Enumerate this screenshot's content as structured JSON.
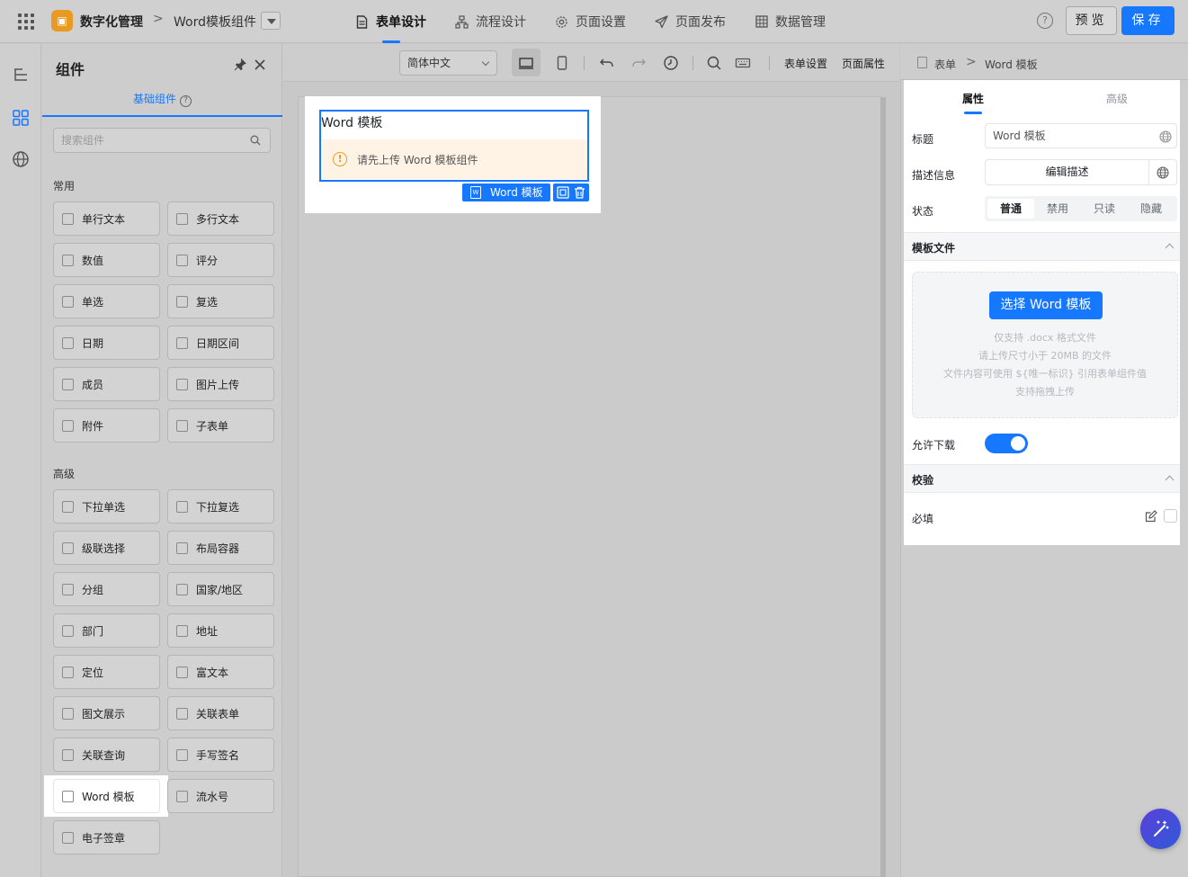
{
  "header": {
    "app_name": "数字化管理",
    "crumb_sep": ">",
    "page_name": "Word模板组件",
    "nav": [
      {
        "label": "表单设计",
        "icon": "file-text-icon",
        "active": true
      },
      {
        "label": "流程设计",
        "icon": "flow-icon",
        "active": false
      },
      {
        "label": "页面设置",
        "icon": "gear-icon",
        "active": false
      },
      {
        "label": "页面发布",
        "icon": "send-icon",
        "active": false
      },
      {
        "label": "数据管理",
        "icon": "table-icon",
        "active": false
      }
    ],
    "help": "?",
    "preview_label": "预览",
    "save_label": "保存"
  },
  "components_panel": {
    "title": "组件",
    "tab_label": "基础组件",
    "tab_help": "?",
    "search_placeholder": "搜索组件",
    "group_common": "常用",
    "group_advanced": "高级",
    "common": [
      "单行文本",
      "多行文本",
      "数值",
      "评分",
      "单选",
      "复选",
      "日期",
      "日期区间",
      "成员",
      "图片上传",
      "附件",
      "子表单"
    ],
    "advanced": [
      "下拉单选",
      "下拉复选",
      "级联选择",
      "布局容器",
      "分组",
      "国家/地区",
      "部门",
      "地址",
      "定位",
      "富文本",
      "图文展示",
      "关联表单",
      "关联查询",
      "手写签名",
      "Word 模板",
      "流水号",
      "电子签章"
    ]
  },
  "toolbar": {
    "language": "简体中文",
    "form_settings": "表单设置",
    "page_props": "页面属性"
  },
  "canvas": {
    "widget_title": "Word 模板",
    "warning_icon": "!",
    "warning": "请先上传 Word 模板组件",
    "tag_label": "Word 模板",
    "tag_icon": "W"
  },
  "properties": {
    "crumb_root": "表单",
    "crumb_sep": ">",
    "crumb_leaf": "Word 模板",
    "tab_props": "属性",
    "tab_advanced": "高级",
    "title_label": "标题",
    "title_value": "Word 模板",
    "desc_label": "描述信息",
    "desc_button": "编辑描述",
    "state_label": "状态",
    "states": [
      "普通",
      "禁用",
      "只读",
      "隐藏"
    ],
    "template_section": "模板文件",
    "upload_button": "选择 Word 模板",
    "upload_hints": [
      "仅支持 .docx 格式文件",
      "请上传尺寸小于 20MB 的文件",
      "文件内容可使用 ${唯一标识} 引用表单组件值",
      "支持拖拽上传"
    ],
    "allow_download_label": "允许下载",
    "allow_download": true,
    "validation_section": "校验",
    "required_label": "必填",
    "required": false
  },
  "colors": {
    "accent": "#1677ff",
    "warning": "#f29a1f"
  }
}
